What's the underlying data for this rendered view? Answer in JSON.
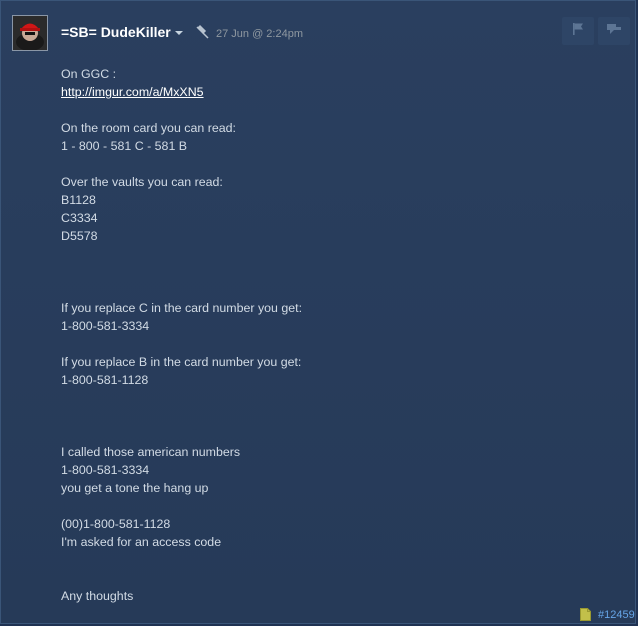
{
  "author": {
    "name": "=SB= DudeKiller"
  },
  "post": {
    "date": "27 Jun @ 2:24pm",
    "number": "#12459",
    "lines": [
      "On GGC :",
      "http://imgur.com/a/MxXN5",
      "",
      "On the room card you can read:",
      "1 - 800 - 581 C - 581 B",
      "",
      "Over the vaults you can read:",
      "B1128",
      "C3334",
      "D5578",
      "",
      "",
      "",
      "If you replace C in the card number you get:",
      "1-800-581-3334",
      "",
      "If you replace B in the card number you get:",
      "1-800-581-1128",
      "",
      "",
      "",
      "I called those american numbers",
      "1-800-581-3334",
      "you get a tone the hang up",
      "",
      "(00)1-800-581-1128",
      "I'm asked for an access code",
      "",
      "",
      "Any thoughts"
    ],
    "link_line_index": 1
  },
  "icons": {
    "avatar": "avatar-image",
    "pin": "pin-icon",
    "flag": "flag-icon",
    "quote": "quote-icon",
    "page": "page-icon",
    "dropdown": "chevron-down-icon"
  },
  "colors": {
    "background": "#263a58",
    "author": "#ffffff",
    "text": "#d2dbe5",
    "link": "#ffffff",
    "post_number": "#66a5e8"
  }
}
